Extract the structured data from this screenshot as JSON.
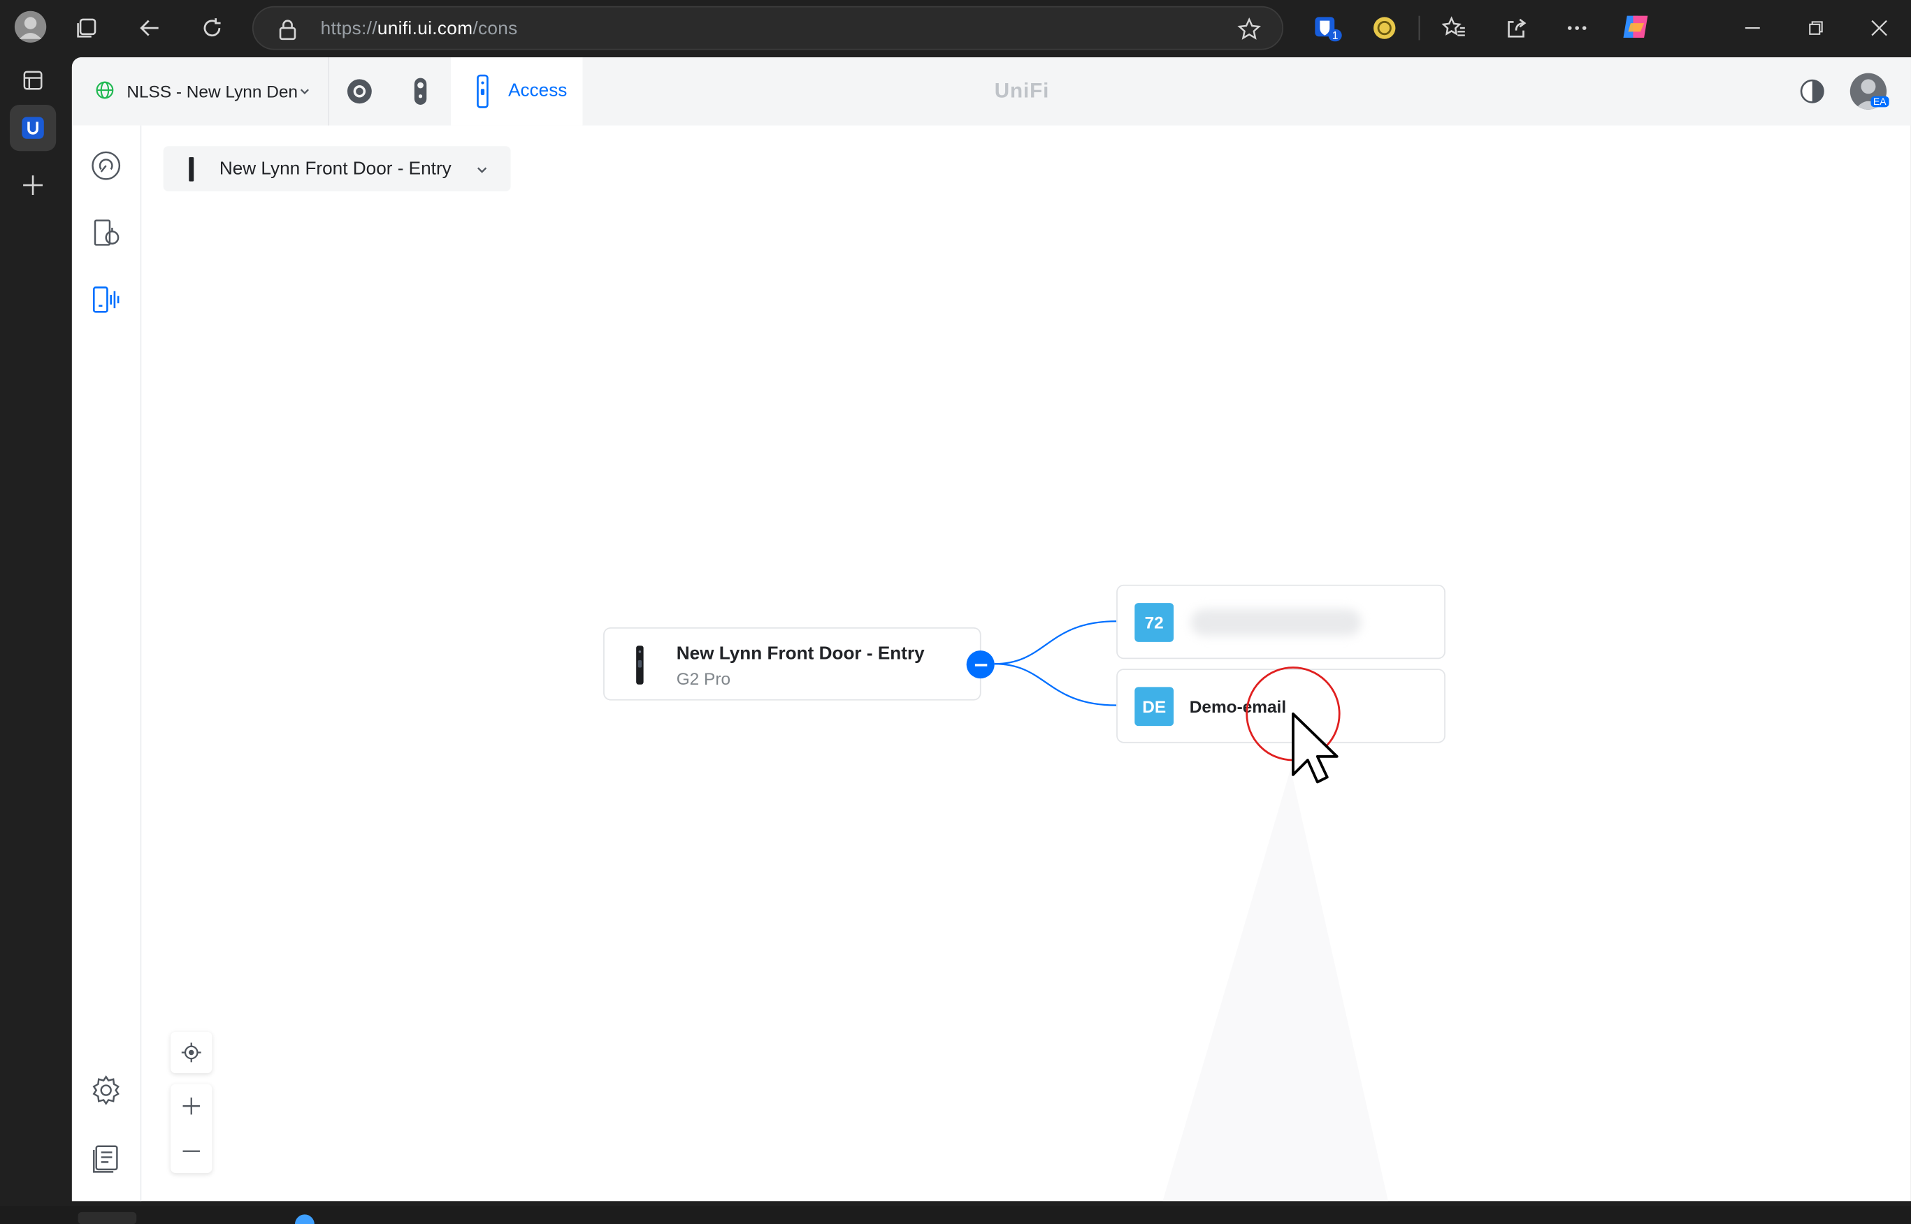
{
  "browser": {
    "url_prefix": "https://",
    "url_domain": "unifi.ui.com",
    "url_path": "/cons",
    "extension_badge": "1"
  },
  "app": {
    "site_name": "NLSS - New Lynn Den",
    "active_tab": "Access",
    "brand": "UniFi",
    "avatar_initials": "EA"
  },
  "door_selector": {
    "label": "New Lynn Front Door - Entry"
  },
  "topology": {
    "device": {
      "name": "New Lynn Front Door - Entry",
      "model": "G2 Pro"
    },
    "users": [
      {
        "badge": "72",
        "name": ""
      },
      {
        "badge": "DE",
        "name": "Demo-email"
      }
    ]
  },
  "colors": {
    "accent": "#006fff",
    "avatar_badge": "#3fb1e8",
    "cursor_highlight": "#e02020"
  }
}
